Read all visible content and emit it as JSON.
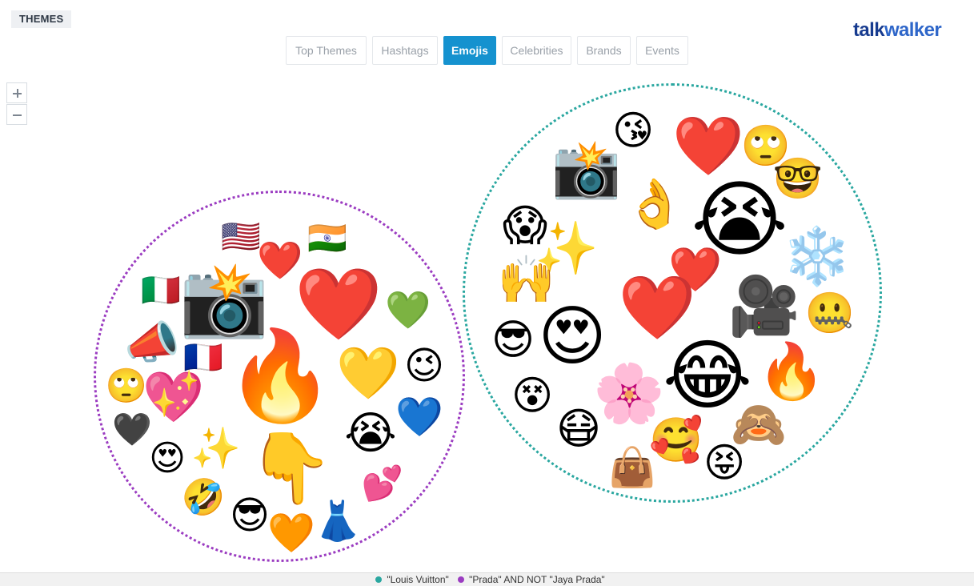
{
  "header": {
    "section_label": "THEMES"
  },
  "brand": {
    "part1": "talk",
    "part2": "walker"
  },
  "tabs": [
    {
      "label": "Top Themes",
      "active": false
    },
    {
      "label": "Hashtags",
      "active": false
    },
    {
      "label": "Emojis",
      "active": true
    },
    {
      "label": "Celebrities",
      "active": false
    },
    {
      "label": "Brands",
      "active": false
    },
    {
      "label": "Events",
      "active": false
    }
  ],
  "zoom": {
    "in_icon": "plus-icon",
    "out_icon": "minus-icon"
  },
  "colors": {
    "accent": "#1592cf",
    "louis_vuitton": "#2aa7a0",
    "prada": "#9b3cc1",
    "brand_dark": "#173b8f",
    "brand_light": "#2e66c9"
  },
  "clusters": [
    {
      "name": "prada",
      "emojis": [
        "🇺🇸",
        "🇮🇳",
        "❤️",
        "🇮🇹",
        "📸",
        "❤️",
        "💚",
        "📣",
        "🇫🇷",
        "🔥",
        "💛",
        "😉",
        "🙄",
        "💖",
        "💙",
        "🖤",
        "😭",
        "😍",
        "✨",
        "👇",
        "💕",
        "🤣",
        "😎",
        "🧡",
        "👗"
      ]
    },
    {
      "name": "louis-vuitton",
      "emojis": [
        "😘",
        "❤️",
        "🙄",
        "📸",
        "🤓",
        "👌",
        "😭",
        "😱",
        "✨",
        "❄️",
        "🙌",
        "❤️",
        "❤️",
        "🎥",
        "🤐",
        "😎",
        "😍",
        "😂",
        "🔥",
        "😵",
        "🌸",
        "🙈",
        "😷",
        "🥰",
        "👜",
        "😝"
      ]
    }
  ],
  "legend": [
    {
      "label": "\"Louis Vuitton\"",
      "color": "#2aa7a0"
    },
    {
      "label": "\"Prada\" AND NOT \"Jaya Prada\"",
      "color": "#9b3cc1"
    }
  ]
}
